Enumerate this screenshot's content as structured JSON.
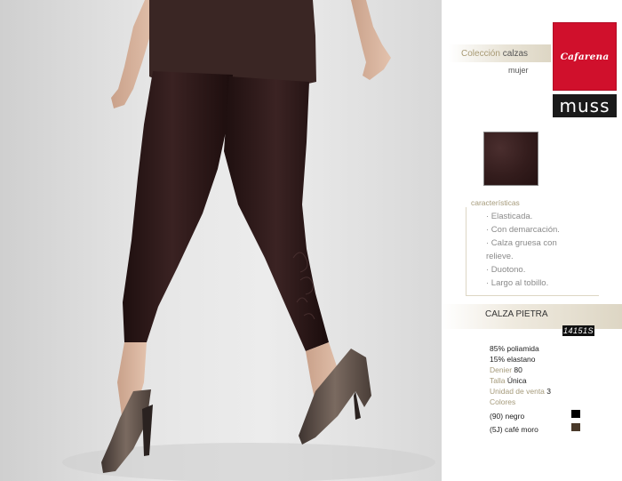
{
  "collection": {
    "title_accent": "Colección",
    "title_rest": "calzas",
    "subtitle": "mujer"
  },
  "brands": {
    "primary": "Cafarena",
    "secondary": "MUSS"
  },
  "features": {
    "label": "características",
    "items": [
      "· Elasticada.",
      "· Con demarcación.",
      "· Calza gruesa con",
      "  relieve.",
      "· Duotono.",
      "· Largo al tobillo."
    ]
  },
  "product": {
    "name": "CALZA PIETRA",
    "code": "14151S"
  },
  "specs": {
    "composition_1": "85% poliamida",
    "composition_2": "15% elastano",
    "denier_label": "Denier",
    "denier_value": "80",
    "size_label": "Talla",
    "size_value": "Única",
    "unit_label": "Unidad de venta",
    "unit_value": "3",
    "colors_label": "Colores",
    "colors": [
      {
        "label": "(90) negro",
        "hex": "#000000"
      },
      {
        "label": "(5J) café moro",
        "hex": "#4a3a2a"
      }
    ]
  },
  "palette": {
    "brand_red": "#d0102c",
    "legging": "#2a1616",
    "accent_gold": "#a59a7a"
  }
}
